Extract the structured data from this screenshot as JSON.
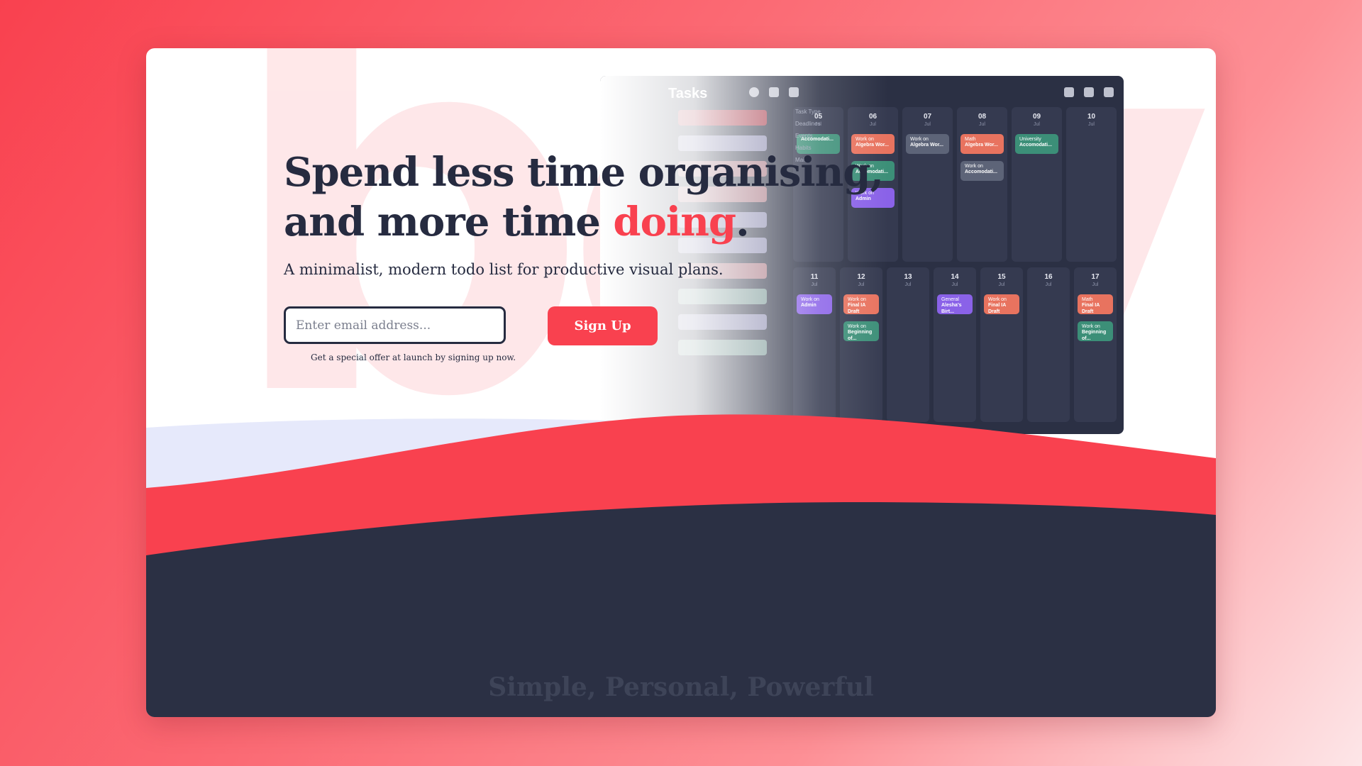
{
  "hero": {
    "headline_line1": "Spend less time organising,",
    "headline_line2_pre": "and more time ",
    "headline_accent": "doing",
    "headline_end": ".",
    "subtitle": "A minimalist, modern todo list for productive visual plans.",
    "email_placeholder": "Enter email address...",
    "signup_label": "Sign Up",
    "offer_text": "Get a special offer at launch by signing up now."
  },
  "preview": {
    "title": "Tasks",
    "filter": {
      "heading": "Task Type",
      "items": [
        "Deadlines",
        "Events",
        "Habits",
        "Main"
      ]
    },
    "week1": [
      {
        "num": "05",
        "mon": "Jul",
        "tasks": [
          {
            "title": "Accomodati...",
            "sub": "",
            "color": "green"
          }
        ]
      },
      {
        "num": "06",
        "mon": "Jul",
        "tasks": [
          {
            "title": "Algebra Wor...",
            "sub": "Work on",
            "color": "orange"
          },
          {
            "title": "Accomodati...",
            "sub": "Work on",
            "color": "green"
          },
          {
            "title": "Admin",
            "sub": "Work on",
            "color": "purple"
          }
        ]
      },
      {
        "num": "07",
        "mon": "Jul",
        "tasks": [
          {
            "title": "Algebra Wor...",
            "sub": "Work on",
            "color": "gray"
          }
        ]
      },
      {
        "num": "08",
        "mon": "Jul",
        "tasks": [
          {
            "title": "Algebra Wor...",
            "sub": "Math",
            "color": "orange"
          },
          {
            "title": "Accomodati...",
            "sub": "Work on",
            "color": "gray"
          }
        ]
      },
      {
        "num": "09",
        "mon": "Jul",
        "tasks": [
          {
            "title": "Accomodati...",
            "sub": "University",
            "color": "green"
          }
        ]
      },
      {
        "num": "10",
        "mon": "Jul",
        "tasks": []
      }
    ],
    "week2": [
      {
        "num": "11",
        "mon": "Jul",
        "tasks": [
          {
            "title": "Admin",
            "sub": "Work on",
            "color": "purple"
          }
        ]
      },
      {
        "num": "12",
        "mon": "Jul",
        "tasks": [
          {
            "title": "Final IA Draft",
            "sub": "Work on",
            "color": "orange"
          },
          {
            "title": "Beginning of...",
            "sub": "Work on",
            "color": "green"
          }
        ]
      },
      {
        "num": "13",
        "mon": "Jul",
        "tasks": []
      },
      {
        "num": "14",
        "mon": "Jul",
        "tasks": [
          {
            "title": "Alesha's Birt...",
            "sub": "General",
            "color": "purple"
          }
        ]
      },
      {
        "num": "15",
        "mon": "Jul",
        "tasks": [
          {
            "title": "Final IA Draft",
            "sub": "Work on",
            "color": "orange"
          }
        ]
      },
      {
        "num": "16",
        "mon": "Jul",
        "tasks": []
      },
      {
        "num": "17",
        "mon": "Jul",
        "tasks": [
          {
            "title": "Final IA Draft",
            "sub": "Math",
            "color": "orange"
          },
          {
            "title": "Beginning of...",
            "sub": "Work on",
            "color": "green"
          }
        ]
      }
    ]
  },
  "tagline": "Simple, Personal, Powerful",
  "colors": {
    "accent": "#f9414f",
    "dark": "#262b40",
    "navy_section": "#2b3044",
    "lavender_wave": "#e6e9fb"
  }
}
